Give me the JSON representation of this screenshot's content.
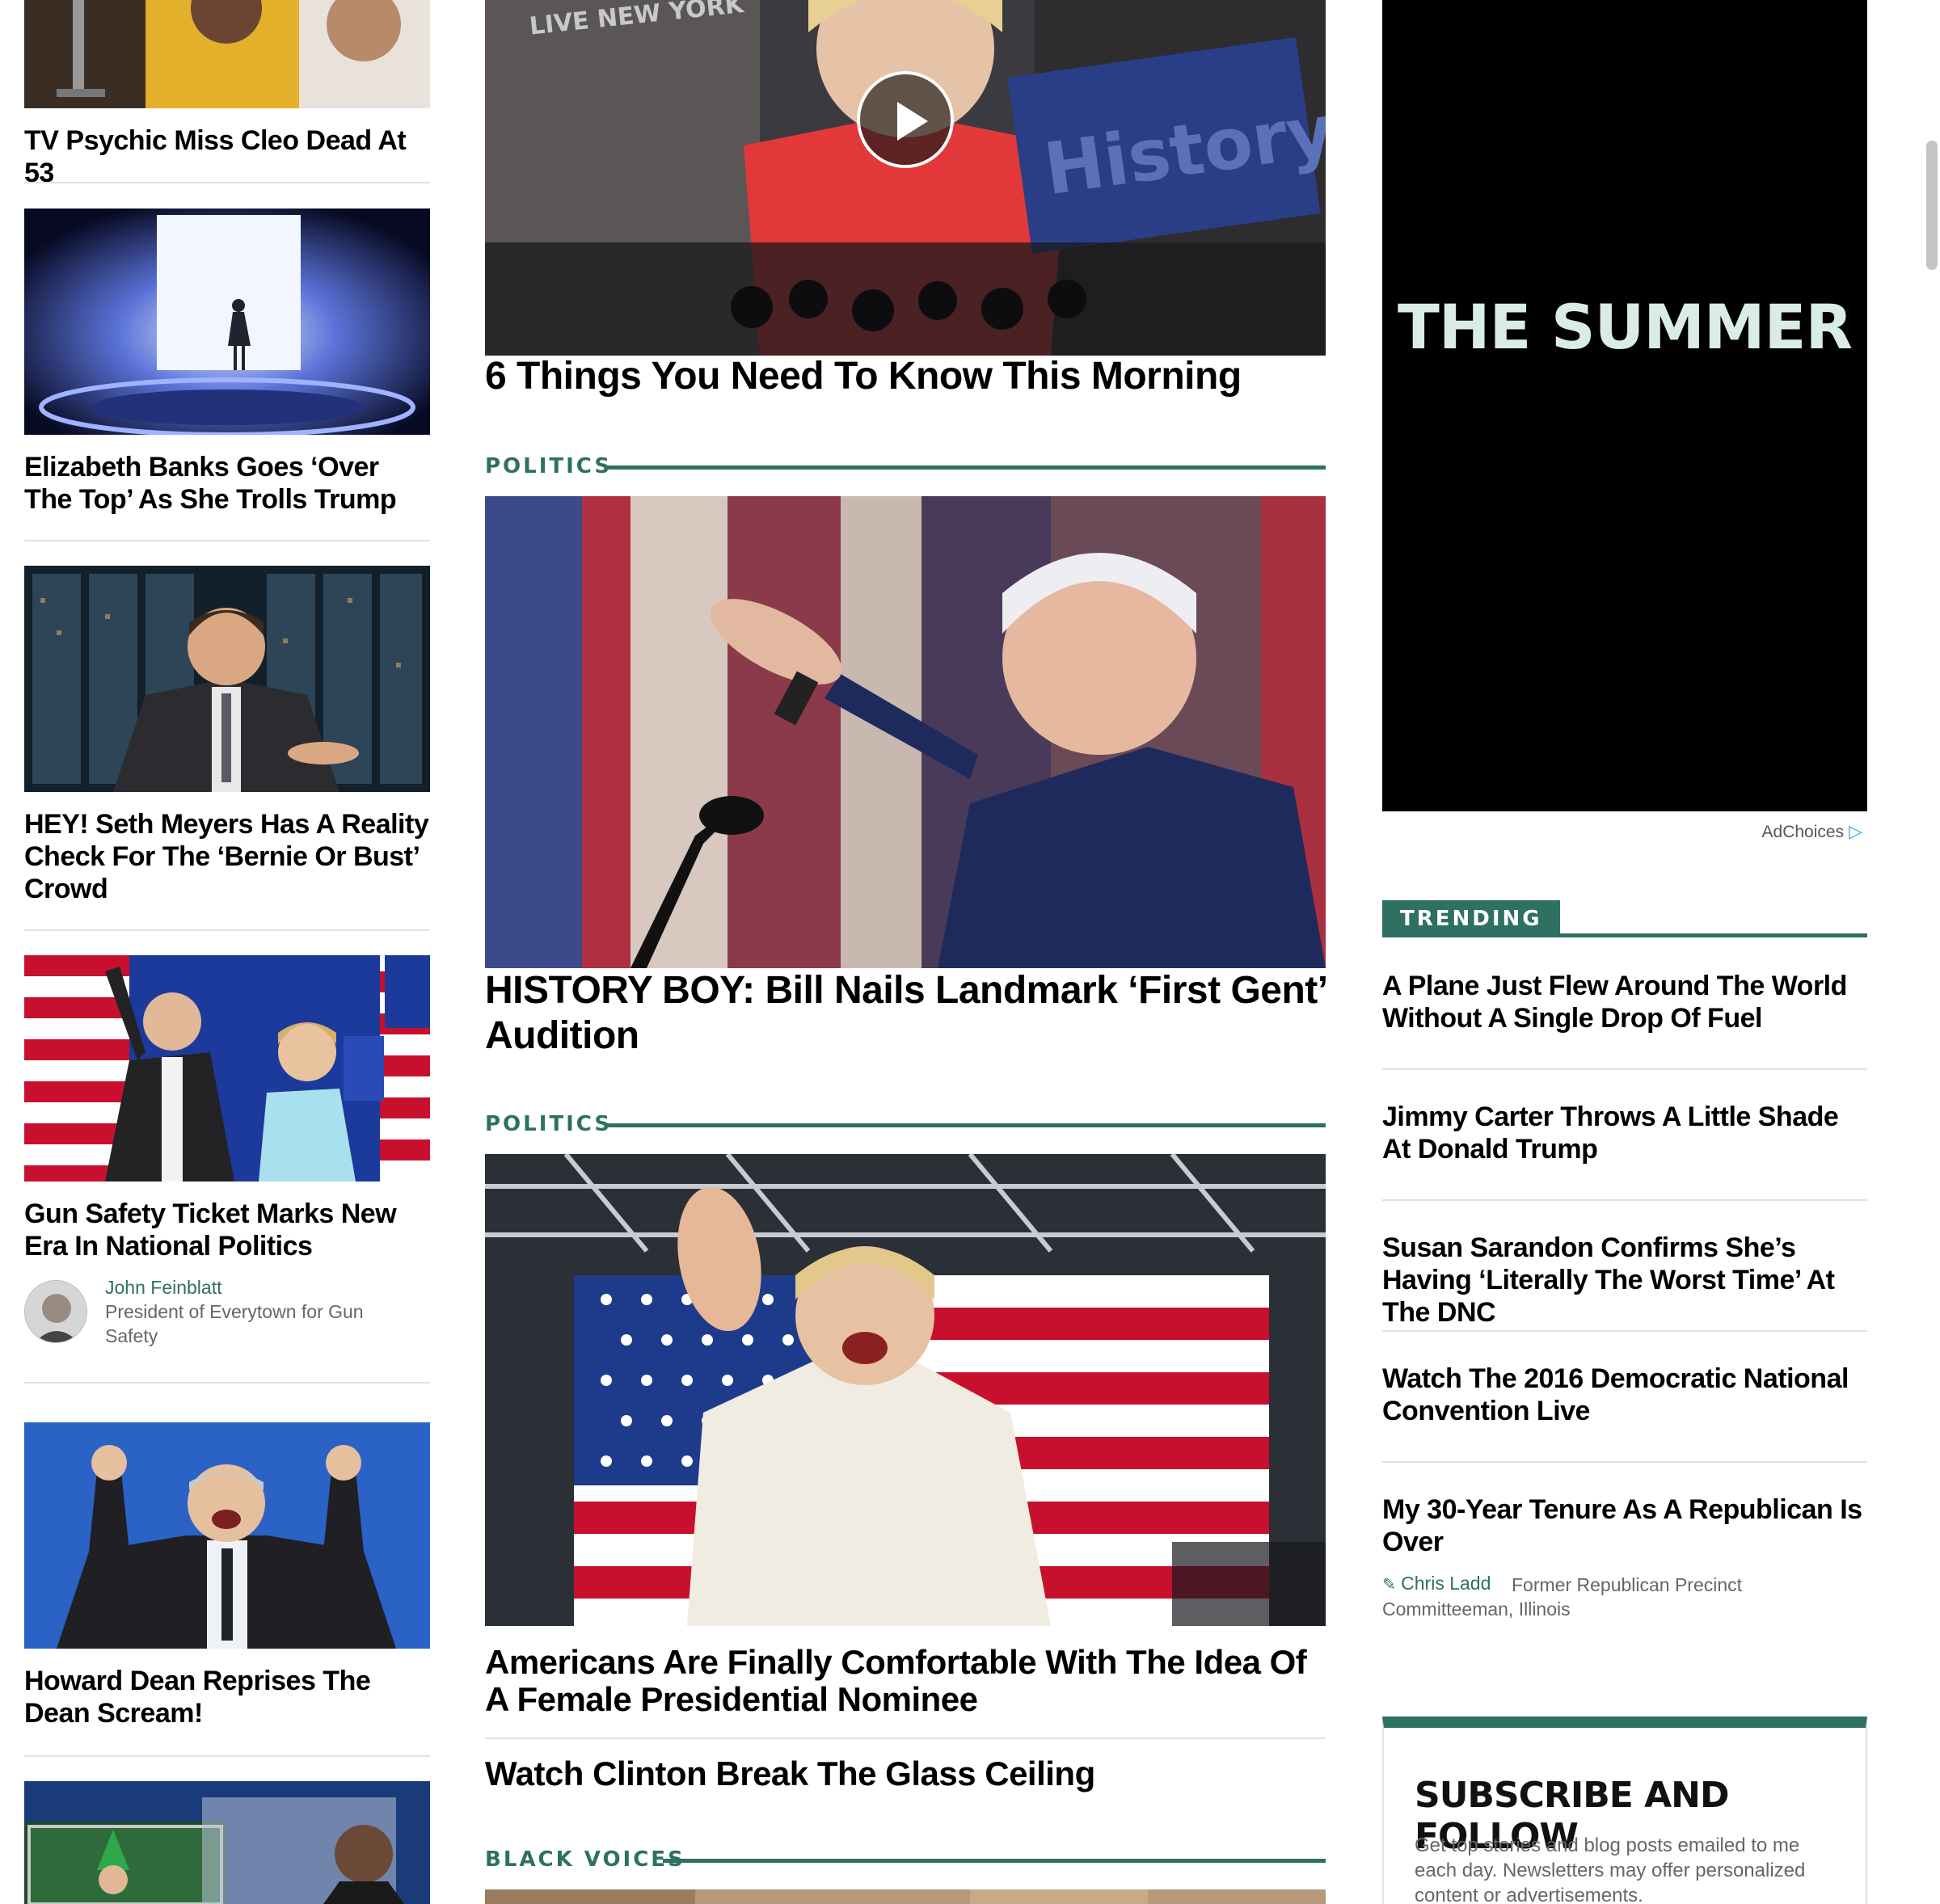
{
  "left": {
    "stories": [
      {
        "headline": "TV Psychic Miss Cleo Dead At 53"
      },
      {
        "headline": "Elizabeth Banks Goes ‘Over The Top’ As She Trolls Trump"
      },
      {
        "headline": "HEY! Seth Meyers Has A Reality Check For The ‘Bernie Or Bust’ Crowd"
      },
      {
        "headline": "Gun Safety Ticket Marks New Era In National Politics",
        "author": "John Feinblatt",
        "author_title": "President of Everytown for Gun Safety"
      },
      {
        "headline": "Howard Dean Reprises The Dean Scream!"
      }
    ]
  },
  "main": {
    "video_overlay": "LIVE NEW YORK",
    "video_sign": "History",
    "lead_headline": "6 Things You Need To Know This Morning",
    "section_1": "POLITICS",
    "story_1": "HISTORY BOY: Bill Nails Landmark ‘First Gent’ Audition",
    "section_2": "POLITICS",
    "story_2": "Americans Are Finally Comfortable With The Idea Of A Female Presidential Nominee",
    "story_2_related": "Watch Clinton Break The Glass Ceiling",
    "section_3": "BLACK VOICES"
  },
  "right": {
    "ad_text": "THE SUMMER",
    "adchoices": "AdChoices",
    "trending_label": "TRENDING",
    "trending": [
      {
        "headline": "A Plane Just Flew Around The World Without A Single Drop Of Fuel"
      },
      {
        "headline": "Jimmy Carter Throws A Little Shade At Donald Trump"
      },
      {
        "headline": "Susan Sarandon Confirms She’s Having ‘Literally The Worst Time’ At The DNC"
      },
      {
        "headline": "Watch The 2016 Democratic National Convention Live"
      },
      {
        "headline": "My 30-Year Tenure As A Republican Is Over",
        "author": "Chris Ladd",
        "author_title": "Former Republican Precinct Committeeman, Illinois"
      }
    ],
    "subscribe": {
      "title": "SUBSCRIBE AND FOLLOW",
      "desc": "Get top stories and blog posts emailed to me each day. Newsletters may offer personalized content or advertisements."
    }
  },
  "colors": {
    "accent": "#2e7061",
    "divider": "#e1e1e1",
    "byline_text": "#666666"
  }
}
